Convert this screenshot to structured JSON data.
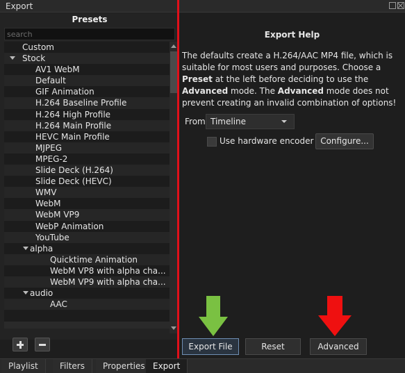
{
  "window": {
    "title": "Export"
  },
  "presets": {
    "title": "Presets",
    "search_placeholder": "search",
    "items": [
      {
        "label": "Custom",
        "level": 0,
        "expandable": false
      },
      {
        "label": "Stock",
        "level": 0,
        "expandable": true
      },
      {
        "label": "AV1 WebM",
        "level": 1,
        "expandable": false
      },
      {
        "label": "Default",
        "level": 1,
        "expandable": false
      },
      {
        "label": "GIF Animation",
        "level": 1,
        "expandable": false
      },
      {
        "label": "H.264 Baseline Profile",
        "level": 1,
        "expandable": false
      },
      {
        "label": "H.264 High Profile",
        "level": 1,
        "expandable": false
      },
      {
        "label": "H.264 Main Profile",
        "level": 1,
        "expandable": false
      },
      {
        "label": "HEVC Main Profile",
        "level": 1,
        "expandable": false
      },
      {
        "label": "MJPEG",
        "level": 1,
        "expandable": false
      },
      {
        "label": "MPEG-2",
        "level": 1,
        "expandable": false
      },
      {
        "label": "Slide Deck (H.264)",
        "level": 1,
        "expandable": false
      },
      {
        "label": "Slide Deck (HEVC)",
        "level": 1,
        "expandable": false
      },
      {
        "label": "WMV",
        "level": 1,
        "expandable": false
      },
      {
        "label": "WebM",
        "level": 1,
        "expandable": false
      },
      {
        "label": "WebM VP9",
        "level": 1,
        "expandable": false
      },
      {
        "label": "WebP Animation",
        "level": 1,
        "expandable": false
      },
      {
        "label": "YouTube",
        "level": 1,
        "expandable": false
      },
      {
        "label": "alpha",
        "level": 1,
        "expandable": true
      },
      {
        "label": "Quicktime Animation",
        "level": 2,
        "expandable": false
      },
      {
        "label": "WebM VP8 with alpha cha...",
        "level": 2,
        "expandable": false
      },
      {
        "label": "WebM VP9 with alpha cha...",
        "level": 2,
        "expandable": false
      },
      {
        "label": "audio",
        "level": 1,
        "expandable": true
      },
      {
        "label": "AAC",
        "level": 2,
        "expandable": false
      }
    ]
  },
  "help": {
    "title": "Export Help",
    "text_1": "The defaults create a H.264/AAC MP4 file, which is suitable for most users and purposes. Choose a ",
    "text_preset": "Preset",
    "text_2": " at the left before deciding to use the ",
    "text_advanced": "Advanced",
    "text_3": " mode. The ",
    "text_advanced_2": "Advanced",
    "text_4": " mode does not prevent creating an invalid combination of options!"
  },
  "from": {
    "label": "From",
    "selected": "Timeline"
  },
  "hardware": {
    "label": "Use hardware encoder",
    "checked": false
  },
  "configure_label": "Configure...",
  "buttons": {
    "export": "Export File",
    "reset": "Reset",
    "advanced": "Advanced"
  },
  "tabs": [
    "Playlist",
    "Filters",
    "Properties",
    "Export"
  ],
  "active_tab": "Export",
  "colors": {
    "divider": "#e0101a",
    "green_arrow": "#7ac142",
    "red_arrow": "#ef1010"
  }
}
